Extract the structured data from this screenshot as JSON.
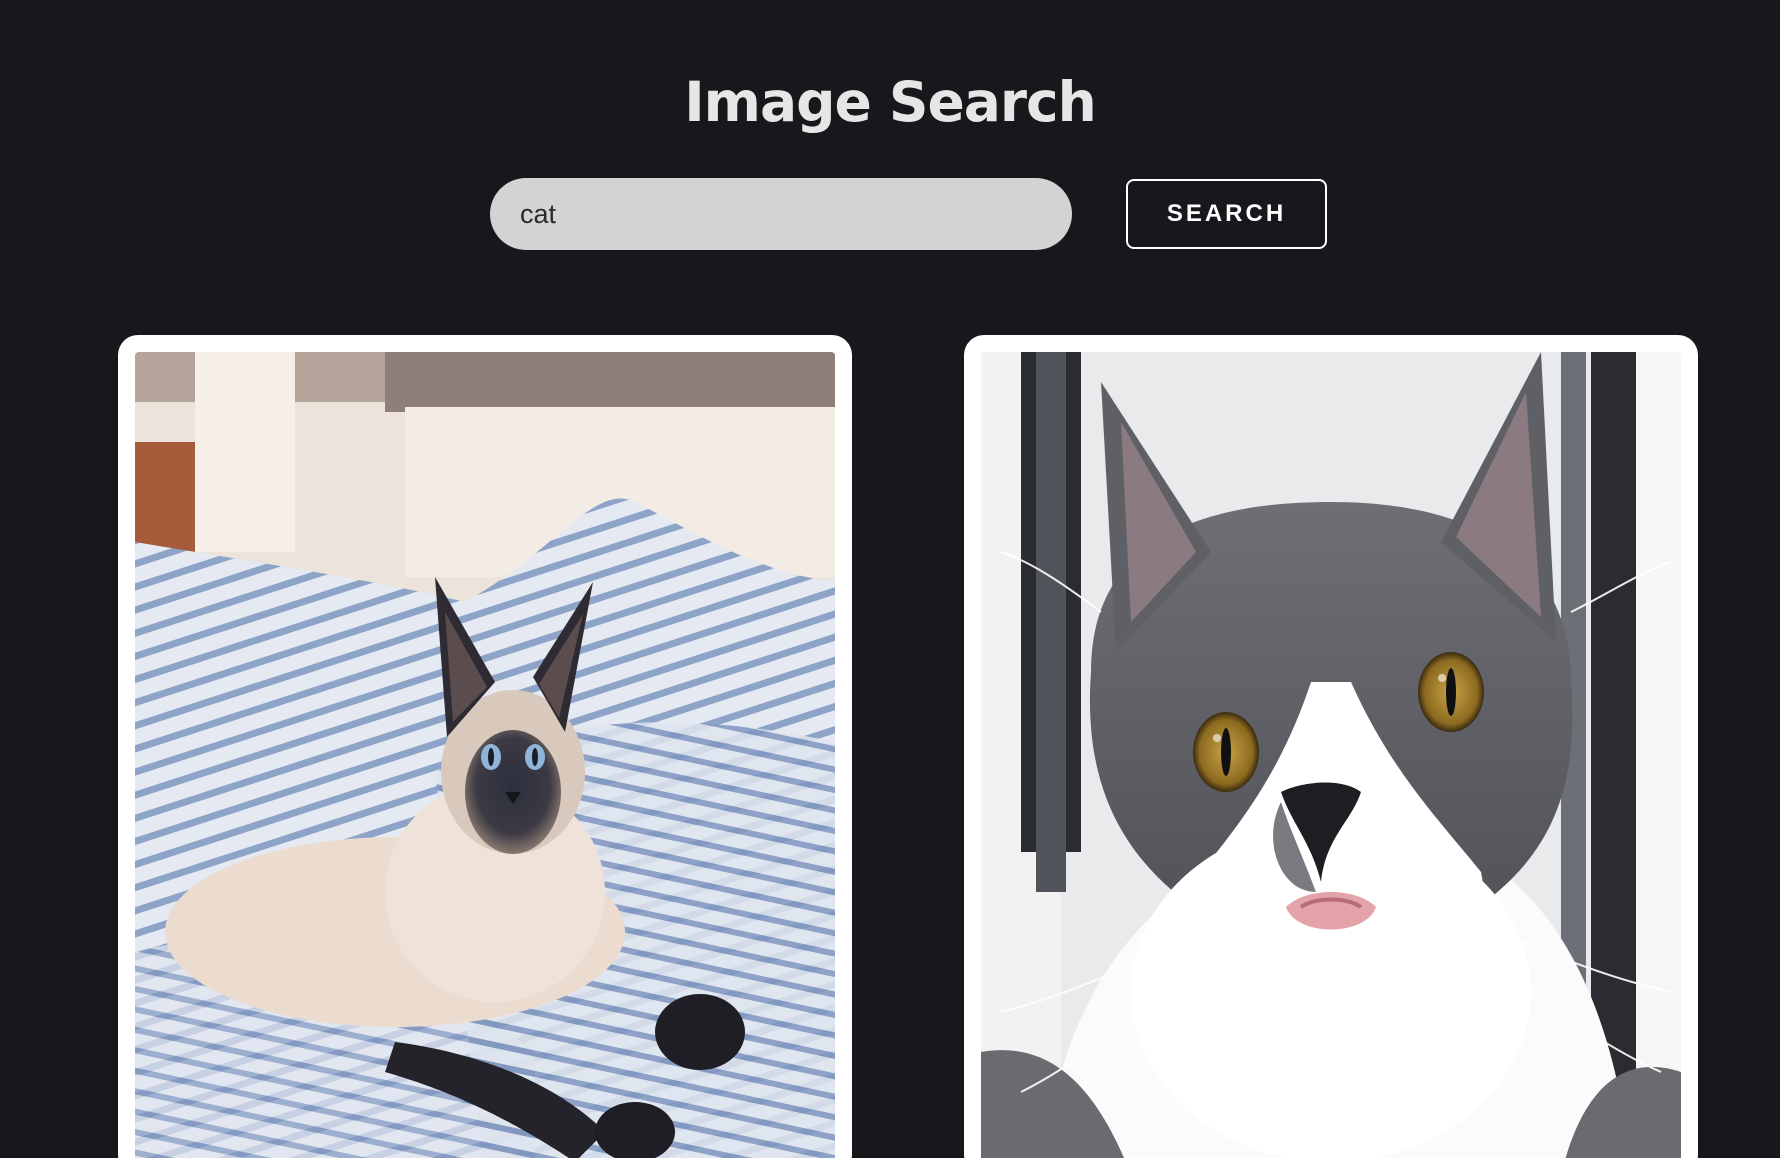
{
  "header": {
    "title": "Image Search"
  },
  "search": {
    "value": "cat",
    "button_label": "SEARCH"
  },
  "results": [
    {
      "subject": "siamese-cat-on-striped-bedsheet"
    },
    {
      "subject": "gray-white-cat-surprised"
    }
  ],
  "colors": {
    "background": "#17171c",
    "title": "#e6e6e6",
    "input_background": "#d3d3d3",
    "card_background": "#ffffff",
    "button_border": "#ffffff"
  }
}
